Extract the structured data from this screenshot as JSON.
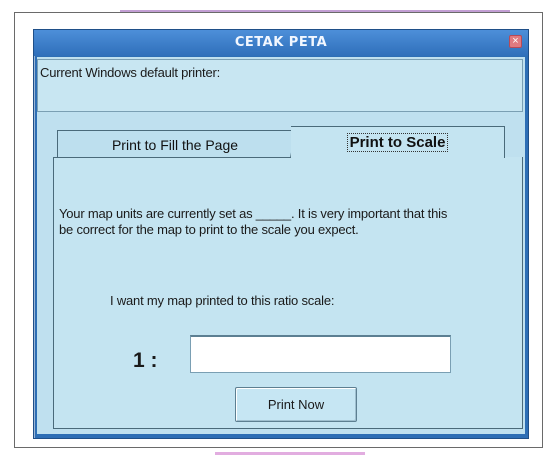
{
  "window": {
    "title": "CETAK PETA",
    "close_glyph": "×"
  },
  "printer": {
    "label": "Current Windows default printer:"
  },
  "tabs": [
    {
      "label": "Print to Fill the Page",
      "selected": false
    },
    {
      "label": "Print to Scale",
      "selected": true
    }
  ],
  "scale_tab": {
    "info_text": "Your map units are currently set as _____.  It is very important that this be correct for the map to print to the scale you expect.",
    "ratio_prompt": "I want my map printed to this ratio scale:",
    "ratio_prefix": "1 :",
    "ratio_value": "",
    "print_button_label": "Print Now"
  },
  "colors": {
    "titlebar": "#2f6fba",
    "client_background": "#bfe0ef",
    "close_button": "#e07a80"
  },
  "icons": {
    "close": "close-icon"
  }
}
